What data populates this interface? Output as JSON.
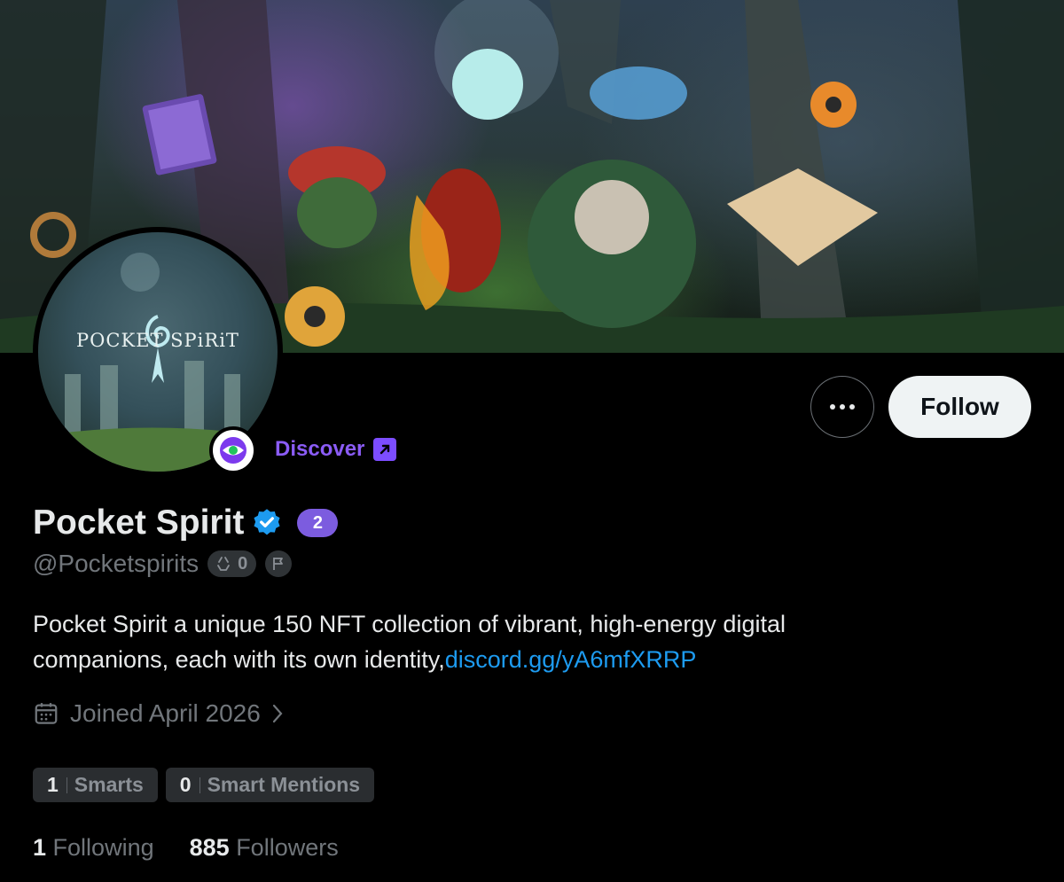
{
  "banner": {
    "alt": "Pocket Spirit characters in a forest"
  },
  "avatar": {
    "logo_text": "POCKET SPiRiT"
  },
  "discover": {
    "label": "Discover",
    "icon": "external-link-icon"
  },
  "actions": {
    "more_icon": "more-horizontal-icon",
    "follow_label": "Follow"
  },
  "profile": {
    "display_name": "Pocket Spirit",
    "verified_icon": "verified-badge-icon",
    "badge_count": "2",
    "handle": "@Pocketspirits",
    "recycle_count": "0",
    "bio_text": "Pocket Spirit a unique 150 NFT collection of vibrant, high-energy digital companions, each with its own identity,",
    "bio_link": "discord.gg/yA6mfXRRP",
    "joined": "Joined April 2026"
  },
  "pills": [
    {
      "count": "1",
      "label": "Smarts"
    },
    {
      "count": "0",
      "label": "Smart Mentions"
    }
  ],
  "stats": {
    "following_count": "1",
    "following_label": "Following",
    "followers_count": "885",
    "followers_label": "Followers"
  },
  "colors": {
    "accent_purple": "#8b5cf6",
    "link_blue": "#1d9bf0",
    "verified_blue": "#1d9bf0",
    "background": "#000000"
  }
}
